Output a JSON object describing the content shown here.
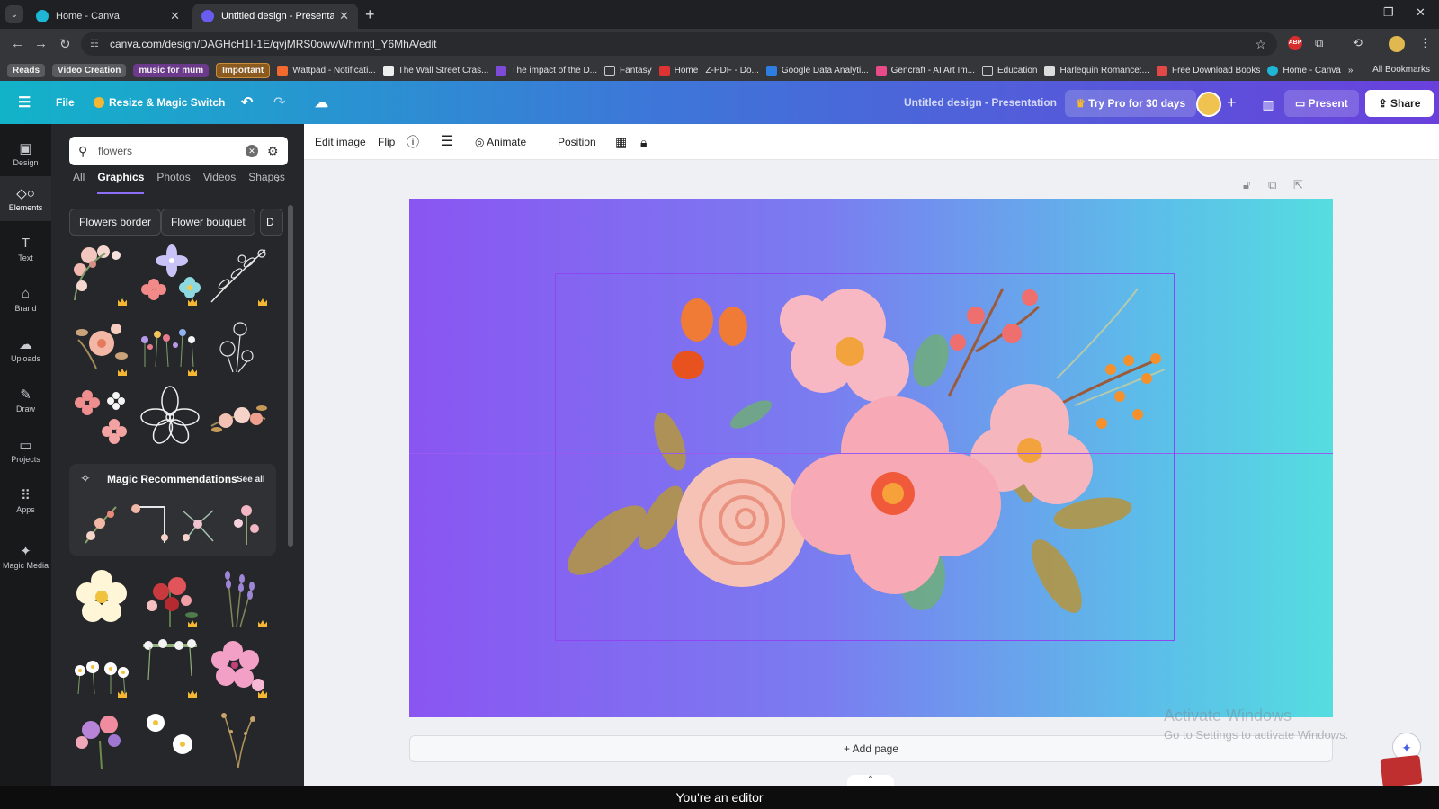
{
  "browser": {
    "tabs": [
      {
        "title": "Home - Canva",
        "active": false
      },
      {
        "title": "Untitled design - Presentation",
        "active": true
      }
    ],
    "url": "canva.com/design/DAGHcH1I-1E/qvjMRS0owwWhmntl_Y6MhA/edit",
    "bookmarks": [
      "Reads",
      "Video Creation",
      "music for mum",
      "Important",
      "Wattpad - Notificati...",
      "The Wall Street Cras...",
      "The impact of the D...",
      "Fantasy",
      "Home | Z-PDF - Do...",
      "Google Data Analyti...",
      "Gencraft - AI Art Im...",
      "Education",
      "Harlequin Romance:...",
      "Free Download Books",
      "Home - Canva"
    ],
    "all_bookmarks": "All Bookmarks"
  },
  "header": {
    "file": "File",
    "resize": "Resize & Magic Switch",
    "title": "Untitled design - Presentation",
    "try_pro": "Try Pro for 30 days",
    "present": "Present",
    "share": "Share"
  },
  "rail": [
    "Design",
    "Elements",
    "Text",
    "Brand",
    "Uploads",
    "Draw",
    "Projects",
    "Apps",
    "Magic Media"
  ],
  "panel": {
    "search_value": "flowers",
    "tabs": [
      "All",
      "Graphics",
      "Photos",
      "Videos",
      "Shapes"
    ],
    "active_tab": "Graphics",
    "chips": [
      "Flowers border",
      "Flower bouquet",
      "D"
    ],
    "magic_title": "Magic Recommendations",
    "see_all": "See all"
  },
  "toolbar": {
    "edit_image": "Edit image",
    "flip": "Flip",
    "animate": "Animate",
    "position": "Position"
  },
  "workspace": {
    "add_page": "+ Add page",
    "watermark_title": "Activate Windows",
    "watermark_sub": "Go to Settings to activate Windows."
  },
  "status": "You're an editor",
  "colors": {
    "accent": "#8b3dff",
    "header_gradient": [
      "#12b3c9",
      "#3d77d8",
      "#6a40dc"
    ],
    "canvas_gradient": [
      "#8a55f2",
      "#55dde0"
    ]
  }
}
